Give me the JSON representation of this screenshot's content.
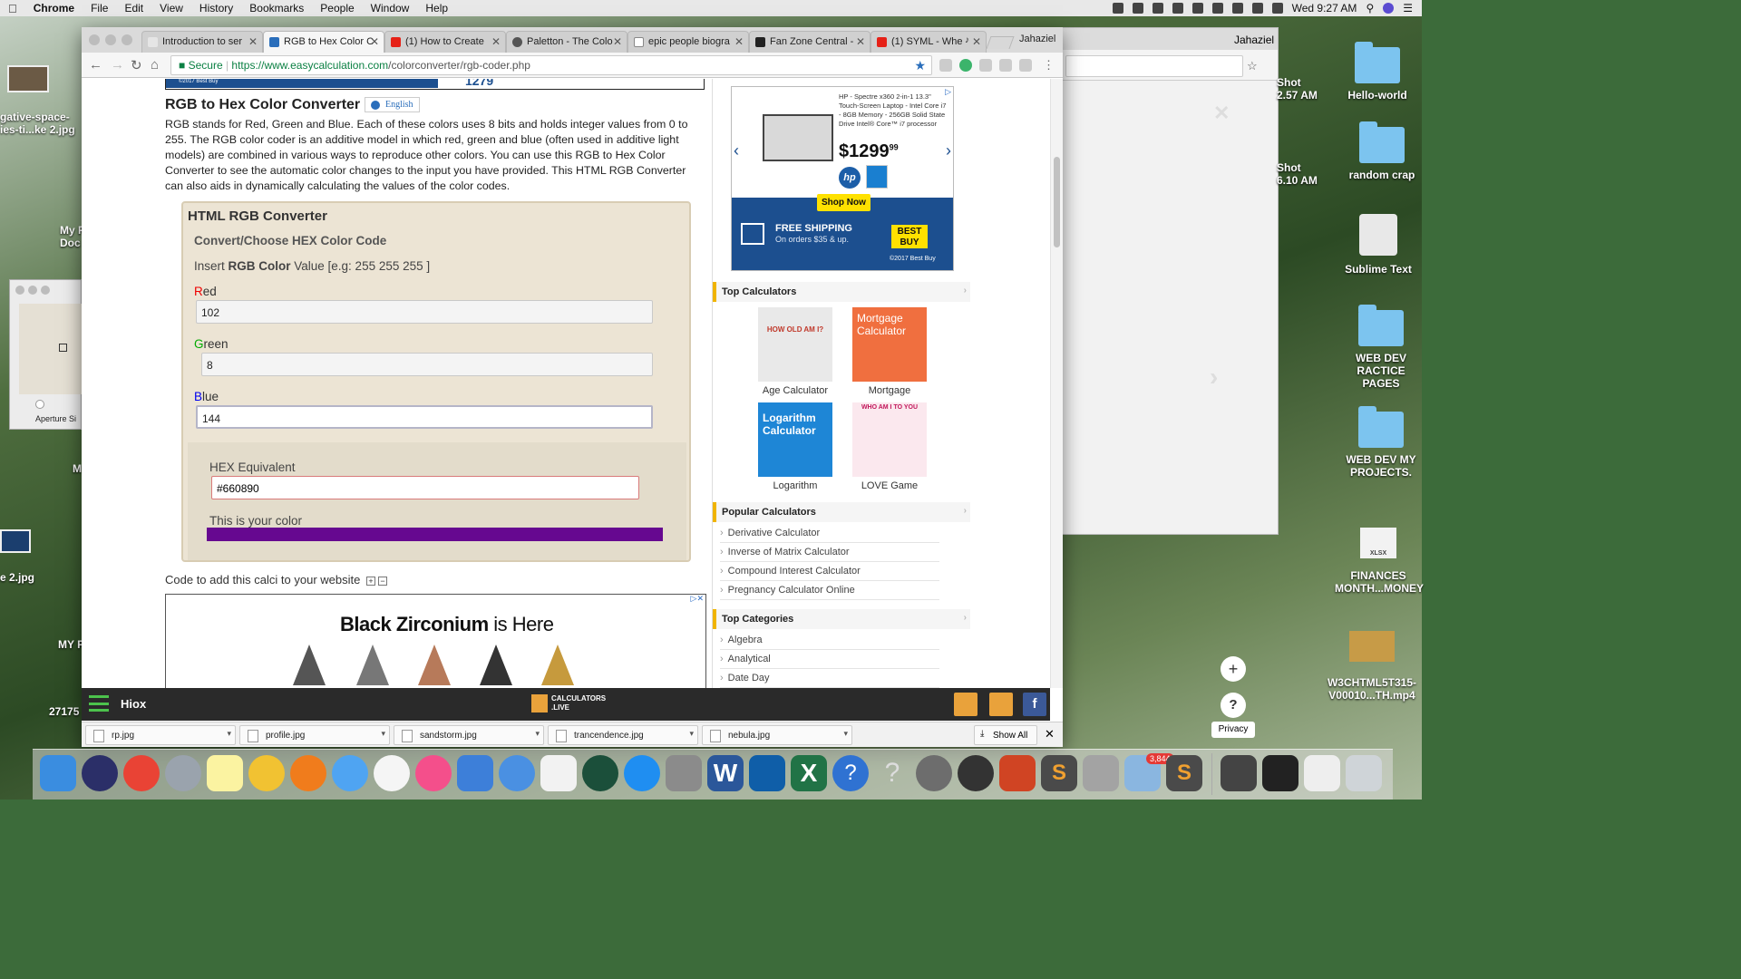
{
  "menubar": {
    "app": "Chrome",
    "items": [
      "File",
      "Edit",
      "View",
      "History",
      "Bookmarks",
      "People",
      "Window",
      "Help"
    ],
    "clock": "Wed 9:27 AM"
  },
  "desktop": {
    "left_labels": [
      "gative-space-",
      "ies-ti...ke 2.jpg",
      "My F",
      "Doc",
      "M",
      "e 2.jpg",
      "MY P",
      "27175"
    ],
    "shot1": [
      "Shot",
      "2.57 AM"
    ],
    "shot2": [
      "Shot",
      "6.10 AM"
    ],
    "right_icons": [
      "Hello-world",
      "random crap",
      "Sublime Text",
      "WEB DEV RACTICE PAGES",
      "WEB DEV MY PROJECTS.",
      "FINANCES MONTH...MONEY",
      "W3CHTML5T315-V00010...TH.mp4"
    ],
    "xlsx": "XLSX",
    "preview_label": "Aperture Si",
    "privacy": "Privacy",
    "back_window_user": "Jahaziel"
  },
  "browser": {
    "profile": "Jahaziel",
    "tabs": [
      {
        "label": "Introduction to ser",
        "fav": "#e5e5e5"
      },
      {
        "label": "RGB to Hex Color C",
        "fav": "#2a6ebb",
        "active": true
      },
      {
        "label": "(1) How to Create",
        "fav": "#e62117"
      },
      {
        "label": "Paletton - The Colo",
        "fav": "#555555"
      },
      {
        "label": "epic people biogra",
        "fav": "#ffffff"
      },
      {
        "label": "Fan Zone Central -",
        "fav": "#222222"
      },
      {
        "label": "(1) SYML - Whe",
        "fav": "#e62117"
      }
    ],
    "secure": "Secure",
    "url_host": "https://www.easycalculation.com",
    "url_path": "/colorconverter/rgb-coder.php"
  },
  "page": {
    "top_ad_caption": "©2017 Best Buy",
    "top_ad_price": "1279",
    "title": "RGB to Hex Color Converter",
    "language": "English",
    "intro": "RGB stands for Red, Green and Blue. Each of these colors uses 8 bits and holds integer values from 0 to 255. The RGB color coder is an additive model in which red, green and blue (often used in additive light models) are combined in various ways to reproduce other colors. You can use this RGB to Hex Color Converter to see the automatic color changes to the input you have provided. This HTML RGB Converter can also aids in dynamically calculating the values of the color codes.",
    "converter": {
      "heading": "HTML RGB Converter",
      "subheading": "Convert/Choose HEX Color Code",
      "insert_prefix": "Insert ",
      "insert_bold": "RGB Color",
      "insert_suffix": " Value [e.g: 255 255 255 ]",
      "red_first": "R",
      "red_rest": "ed",
      "red_value": "102",
      "green_first": "G",
      "green_rest": "reen",
      "green_value": "8",
      "blue_first": "B",
      "blue_rest": "lue",
      "blue_value": "144",
      "hex_label": "HEX Equivalent",
      "hex_value": "#660890",
      "swatch_label": "This is your color",
      "swatch_color": "#660890"
    },
    "code_add": "Code to add this calci to your website",
    "bottom_ad_bold": "Black Zirconium",
    "bottom_ad_rest": " is Here"
  },
  "sidebar": {
    "hp_ad": {
      "desc": "HP - Spectre x360 2-in-1 13.3\" Touch-Screen Laptop - Intel Core i7 - 8GB Memory - 256GB Solid State Drive Intel® Core™ i7 processor",
      "price": "$1299",
      "cents": "99",
      "hp": "hp",
      "shop": "Shop Now",
      "shipping": "FREE SHIPPING",
      "shipping_sub": "On orders $35 & up.",
      "bestbuy": "BEST BUY",
      "copyright": "©2017 Best Buy"
    },
    "top_calculators_title": "Top Calculators",
    "top_calculators": [
      {
        "label": "Age Calculator",
        "thumb_text": "HOW OLD AM I?",
        "bg": "#e9e9e9",
        "fg": "#c0392b"
      },
      {
        "label": "Mortgage",
        "thumb_text": "Mortgage Calculator",
        "bg": "#f06f3f",
        "fg": "#ffffff"
      },
      {
        "label": "Logarithm",
        "thumb_text": "Logarithm Calculator",
        "bg": "#1e86d6",
        "fg": "#ffffff"
      },
      {
        "label": "LOVE Game",
        "thumb_text": "WHO AM I TO YOU",
        "bg": "#fbe8ee",
        "fg": "#c2185b"
      }
    ],
    "popular_title": "Popular Calculators",
    "popular": [
      "Derivative Calculator",
      "Inverse of Matrix Calculator",
      "Compound Interest Calculator",
      "Pregnancy Calculator Online"
    ],
    "categories_title": "Top Categories",
    "categories": [
      "Algebra",
      "Analytical",
      "Date Day"
    ]
  },
  "hiox": {
    "name": "Hiox",
    "brand_line1": "CALCULATORS",
    "brand_line2": ".LIVE"
  },
  "downloads": {
    "files": [
      "rp.jpg",
      "profile.jpg",
      "sandstorm.jpg",
      "trancendence.jpg",
      "nebula.jpg"
    ],
    "show_all": "Show All"
  },
  "dock": {
    "badge": "3,844"
  }
}
